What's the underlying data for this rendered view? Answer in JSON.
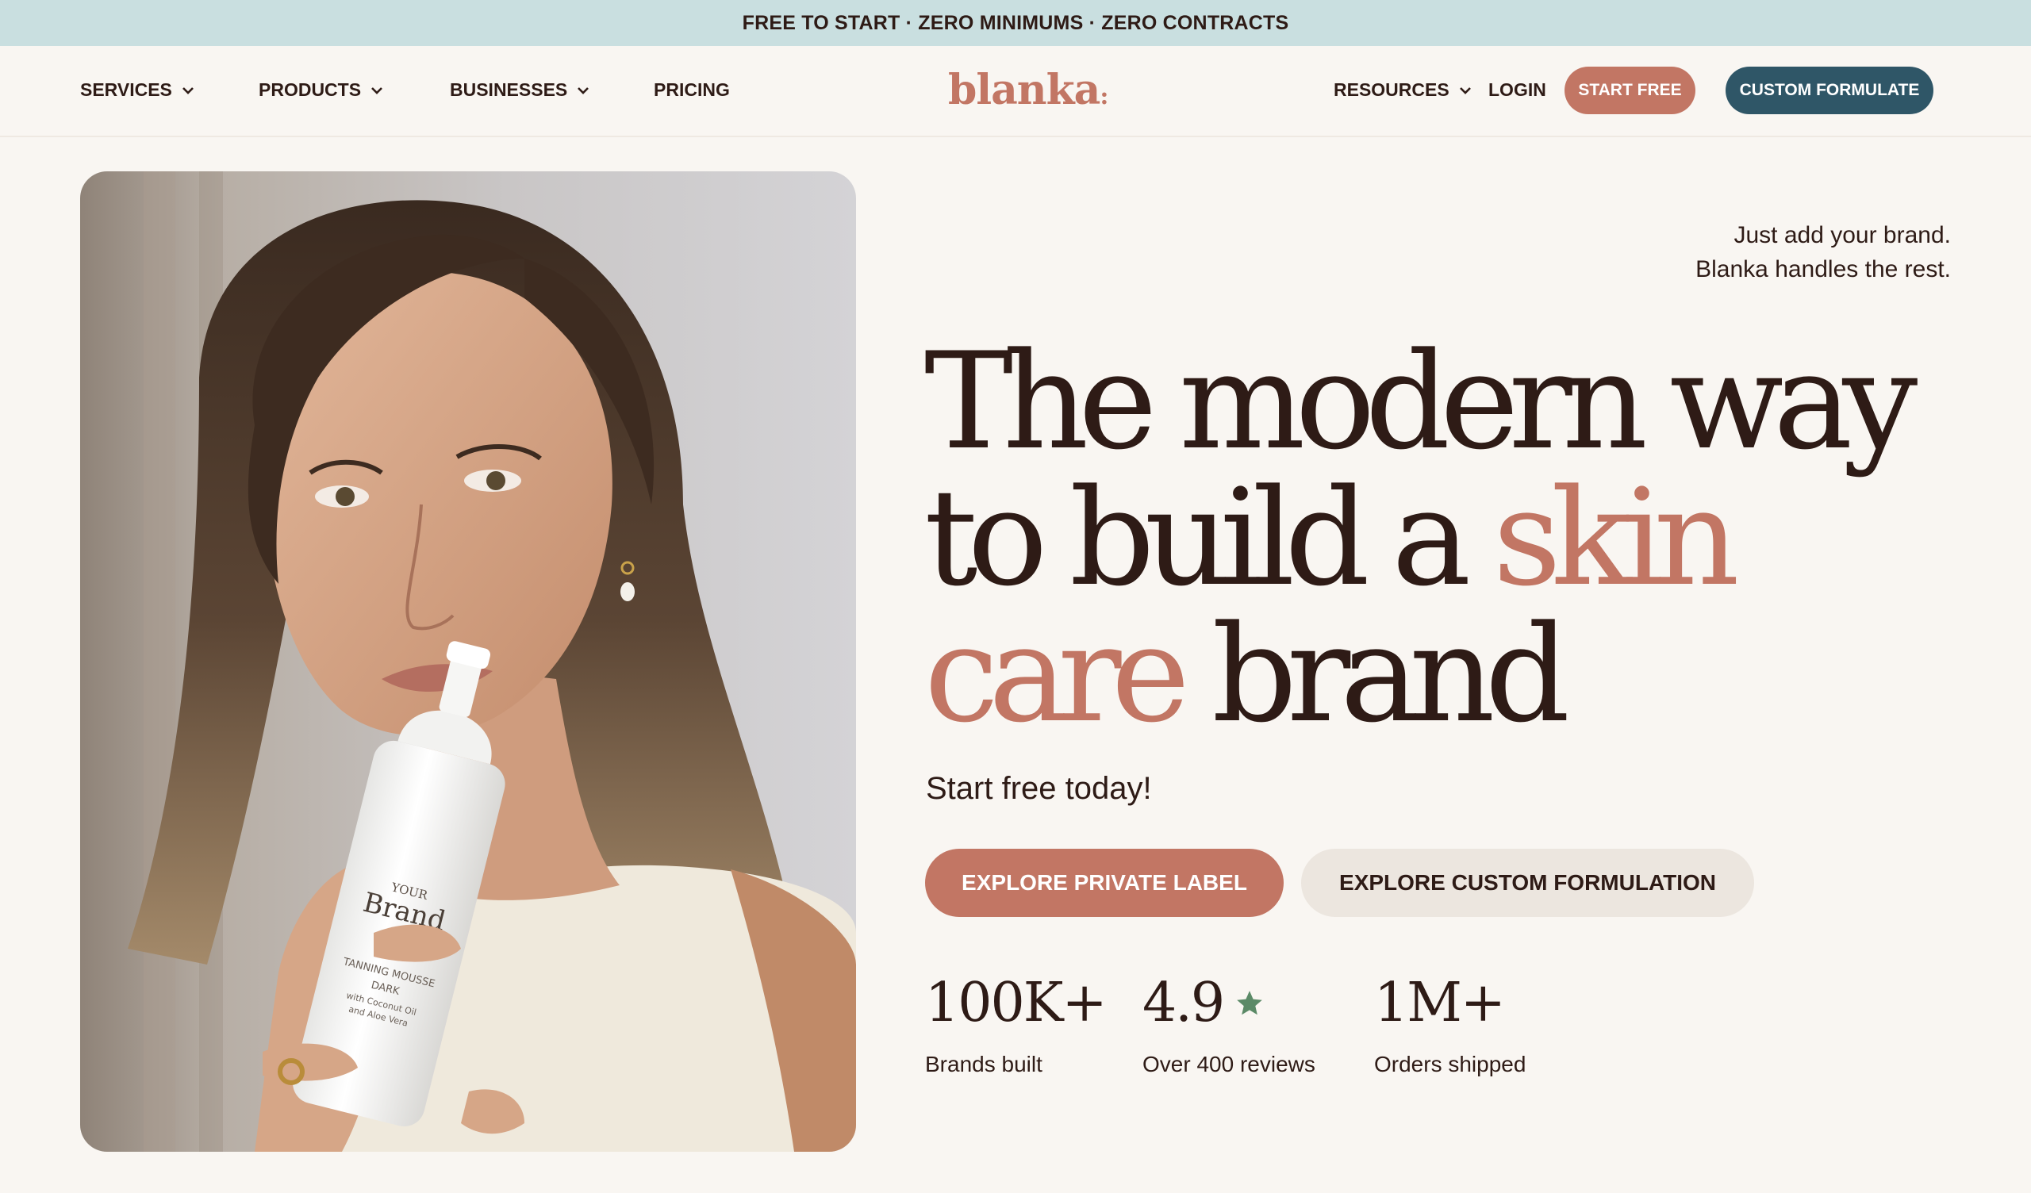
{
  "announcement": {
    "text": "FREE TO START · ZERO MINIMUMS · ZERO CONTRACTS"
  },
  "nav": {
    "services": "SERVICES",
    "products": "PRODUCTS",
    "businesses": "BUSINESSES",
    "pricing": "PRICING",
    "logo": "blanka",
    "resources": "RESOURCES",
    "login": "LOGIN",
    "start_free": "START FREE",
    "custom_formulate": "CUSTOM FORMULATE"
  },
  "hero": {
    "tagline_line1": "Just add your brand.",
    "tagline_line2": "Blanka handles the rest.",
    "headline_part1": "The modern way to build a ",
    "headline_accent": "skin care",
    "headline_part2": " brand",
    "subheading": "Start free today!",
    "cta_primary": "EXPLORE PRIVATE LABEL",
    "cta_secondary": "EXPLORE CUSTOM FORMULATION",
    "bottle": {
      "your": "YOUR",
      "brand": "Brand",
      "product_line1": "TANNING MOUSSE",
      "product_line2": "DARK",
      "product_line3": "with Coconut Oil",
      "product_line4": "and Aloe Vera"
    }
  },
  "stats": [
    {
      "value": "100K+",
      "label": "Brands built"
    },
    {
      "value": "4.9",
      "label": "Over 400 reviews",
      "icon": "star-icon"
    },
    {
      "value": "1M+",
      "label": "Orders shipped"
    }
  ],
  "colors": {
    "accent": "#c27664",
    "dark": "#2e1b16",
    "teal": "#2f5667",
    "announce_bg": "#c9dfe0",
    "page_bg": "#f9f6f2",
    "star": "#5b8a67"
  }
}
